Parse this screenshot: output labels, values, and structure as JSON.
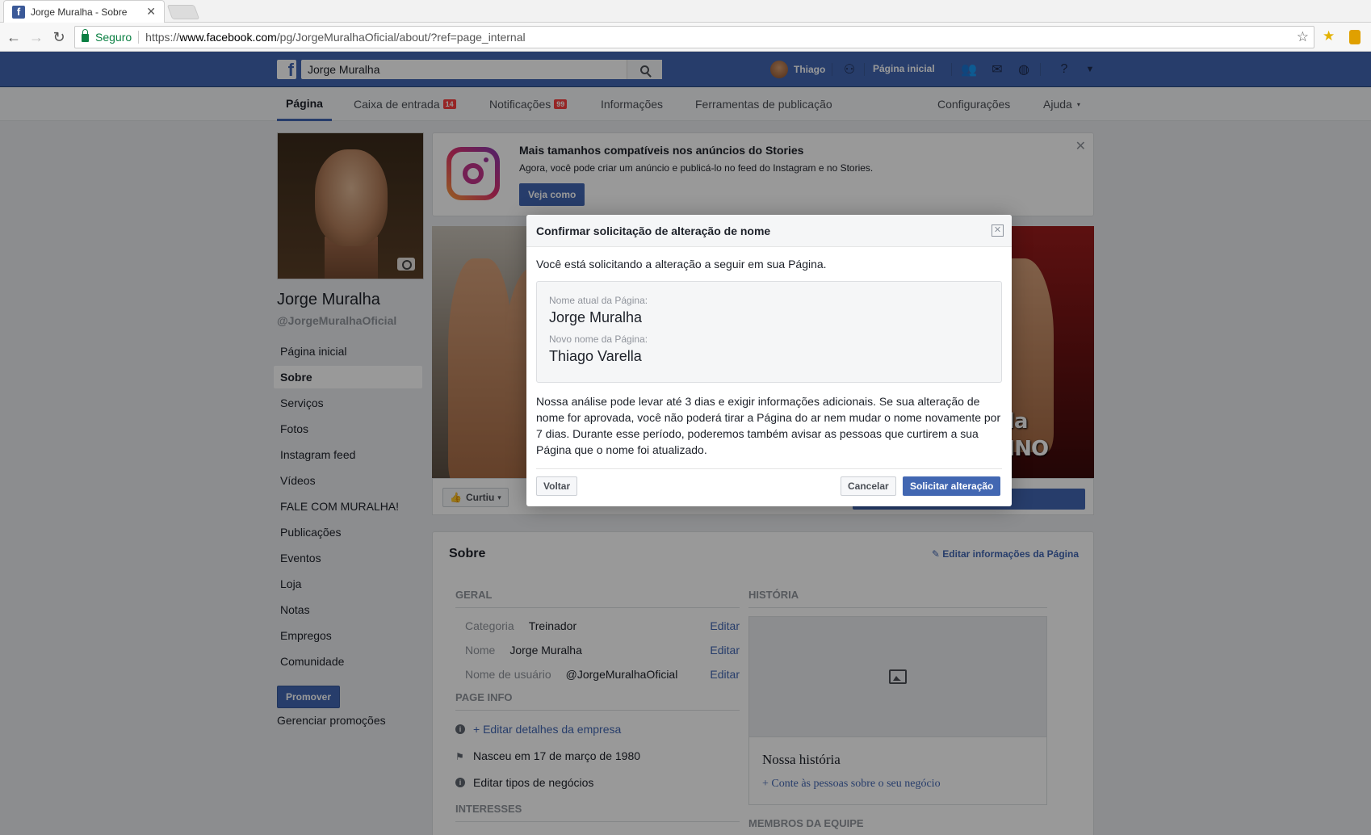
{
  "browser": {
    "tab_title": "Jorge Muralha - Sobre",
    "tab_close": "✕",
    "secure_label": "Seguro",
    "url_prefix": "https://",
    "url_domain": "www.facebook.com",
    "url_path": "/pg/JorgeMuralhaOficial/about/?ref=page_internal"
  },
  "fb_bar": {
    "search_value": "Jorge Muralha",
    "user_name": "Thiago",
    "home_label": "Página inicial"
  },
  "page_nav": {
    "items": [
      {
        "label": "Página"
      },
      {
        "label": "Caixa de entrada",
        "badge": "14"
      },
      {
        "label": "Notificações",
        "badge": "99"
      },
      {
        "label": "Informações"
      },
      {
        "label": "Ferramentas de publicação"
      }
    ],
    "right": [
      {
        "label": "Configurações"
      },
      {
        "label": "Ajuda",
        "caret": "▾"
      }
    ]
  },
  "left": {
    "page_name": "Jorge Muralha",
    "page_handle": "@JorgeMuralhaOficial",
    "menu": [
      "Página inicial",
      "Sobre",
      "Serviços",
      "Fotos",
      "Instagram feed",
      "Vídeos",
      "FALE COM MURALHA!",
      "Publicações",
      "Eventos",
      "Loja",
      "Notas",
      "Empregos",
      "Comunidade"
    ],
    "promote_label": "Promover",
    "manage_promotions": "Gerenciar promoções"
  },
  "banner": {
    "title": "Mais tamanhos compatíveis nos anúncios do Stories",
    "text": "Agora, você pode criar um anúncio e publicá-lo no feed do Instagram e no Stories.",
    "button": "Veja como",
    "close": "✕"
  },
  "cover": {
    "text_line1": "arella",
    "text_line2": "TREINO"
  },
  "actions": {
    "liked_label": "Curtiu",
    "liked_caret": "▾"
  },
  "about": {
    "title": "Sobre",
    "edit_link": "Editar informações da Página",
    "geral": "GERAL",
    "rows": [
      {
        "key": "Categoria",
        "value": "Treinador",
        "edit": "Editar"
      },
      {
        "key": "Nome",
        "value": "Jorge Muralha",
        "edit": "Editar"
      },
      {
        "key": "Nome de usuário",
        "value": "@JorgeMuralhaOficial",
        "edit": "Editar"
      }
    ],
    "page_info": "PAGE INFO",
    "info_rows": [
      "+ Editar detalhes da empresa",
      "Nasceu em 17 de março de 1980",
      "Editar tipos de negócios"
    ],
    "interesses": "INTERESSES",
    "historia": "HISTÓRIA",
    "story_title": "Nossa história",
    "story_link": "+ Conte às pessoas sobre o seu negócio",
    "membros": "MEMBROS DA EQUIPE"
  },
  "dialog": {
    "title": "Confirmar solicitação de alteração de nome",
    "close": "✕",
    "intro": "Você está solicitando a alteração a seguir em sua Página.",
    "current_label": "Nome atual da Página:",
    "current_value": "Jorge Muralha",
    "new_label": "Novo nome da Página:",
    "new_value": "Thiago Varella",
    "note": "Nossa análise pode levar até 3 dias e exigir informações adicionais. Se sua alteração de nome for aprovada, você não poderá tirar a Página do ar nem mudar o nome novamente por 7 dias. Durante esse período, poderemos também avisar as pessoas que curtirem a sua Página que o nome foi atualizado.",
    "back_button": "Voltar",
    "cancel_button": "Cancelar",
    "submit_button": "Solicitar alteração"
  }
}
